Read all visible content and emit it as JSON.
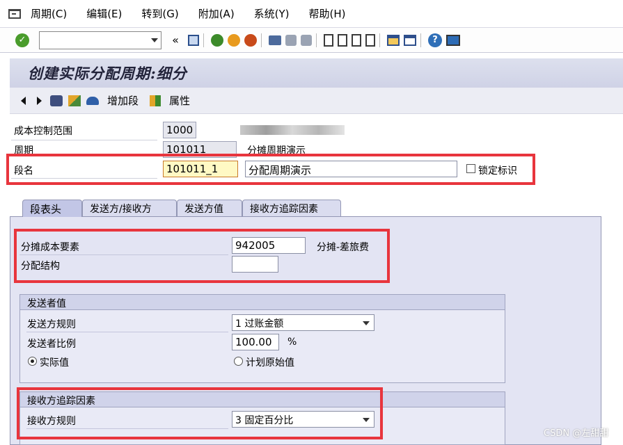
{
  "menu": [
    "周期(C)",
    "编辑(E)",
    "转到(G)",
    "附加(A)",
    "系统(Y)",
    "帮助(H)"
  ],
  "toolbar": {
    "back_symbol": "«"
  },
  "title": "创建实际分配周期:细分",
  "app_toolbar": {
    "add_segment": "增加段",
    "attributes": "属性"
  },
  "header": {
    "controlling_area_label": "成本控制范围",
    "controlling_area_value": "1000",
    "cycle_label": "周期",
    "cycle_value": "101011",
    "cycle_desc": "分摊周期演示",
    "segment_label": "段名",
    "segment_value": "101011_1",
    "segment_desc": "分配周期演示",
    "lock_label": "锁定标识"
  },
  "tabs": [
    "段表头",
    "发送方/接收方",
    "发送方值",
    "接收方追踪因素"
  ],
  "segment_header": {
    "alloc_cost_element_label": "分摊成本要素",
    "alloc_cost_element_value": "942005",
    "alloc_cost_element_desc": "分摊-差旅费",
    "alloc_structure_label": "分配结构",
    "alloc_structure_value": ""
  },
  "sender_values": {
    "title": "发送者值",
    "rule_label": "发送方规则",
    "rule_value": "1 过账金额",
    "share_label": "发送者比例",
    "share_value": "100.00",
    "share_unit": "%",
    "radio_actual": "实际值",
    "radio_plan": "计划原始值"
  },
  "receiver_tracing": {
    "title": "接收方追踪因素",
    "rule_label": "接收方规则",
    "rule_value": "3 固定百分比"
  },
  "watermark": "CSDN @左甜甜"
}
